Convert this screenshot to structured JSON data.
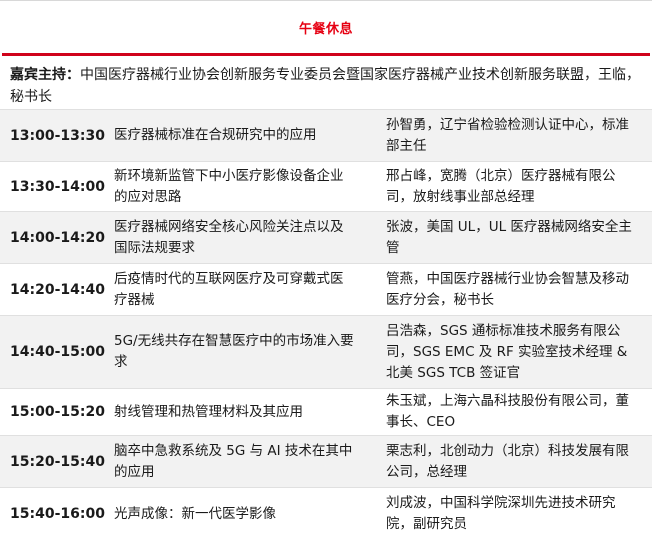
{
  "header": {
    "break_title": "午餐休息"
  },
  "host": {
    "label": "嘉宾主持：",
    "text": "中国医疗器械行业协会创新服务专业委员会暨国家医疗器械产业技术创新服务联盟，王临，秘书长"
  },
  "schedule": [
    {
      "time": "13:00-13:30",
      "topic": "医疗器械标准在合规研究中的应用",
      "speaker": "孙智勇，辽宁省检验检测认证中心，标准部主任"
    },
    {
      "time": "13:30-14:00",
      "topic": "新环境新监管下中小医疗影像设备企业的应对思路",
      "speaker": "邢占峰，宽腾（北京）医疗器械有限公司，放射线事业部总经理"
    },
    {
      "time": "14:00-14:20",
      "topic": "医疗器械网络安全核心风险关注点以及国际法规要求",
      "speaker": "张波，美国 UL，UL 医疗器械网络安全主管"
    },
    {
      "time": "14:20-14:40",
      "topic": "后疫情时代的互联网医疗及可穿戴式医疗器械",
      "speaker": "管燕，中国医疗器械行业协会智慧及移动医疗分会，秘书长"
    },
    {
      "time": "14:40-15:00",
      "topic": "5G/无线共存在智慧医疗中的市场准入要求",
      "speaker": "吕浩森，SGS 通标标准技术服务有限公司，SGS EMC 及 RF 实验室技术经理 & 北美 SGS TCB 签证官"
    },
    {
      "time": "15:00-15:20",
      "topic": "射线管理和热管理材料及其应用",
      "speaker": "朱玉斌，上海六晶科技股份有限公司，董事长、CEO"
    },
    {
      "time": "15:20-15:40",
      "topic": "脑卒中急救系统及 5G 与 AI 技术在其中的应用",
      "speaker": "栗志利，北创动力（北京）科技发展有限公司，总经理"
    },
    {
      "time": "15:40-16:00",
      "topic": "光声成像：新一代医学影像",
      "speaker": "刘成波，中国科学院深圳先进技术研究院，副研究员"
    }
  ],
  "colors": {
    "accent": "#e60012",
    "rule": "#d0021b",
    "shade": "#f2f2f2"
  }
}
